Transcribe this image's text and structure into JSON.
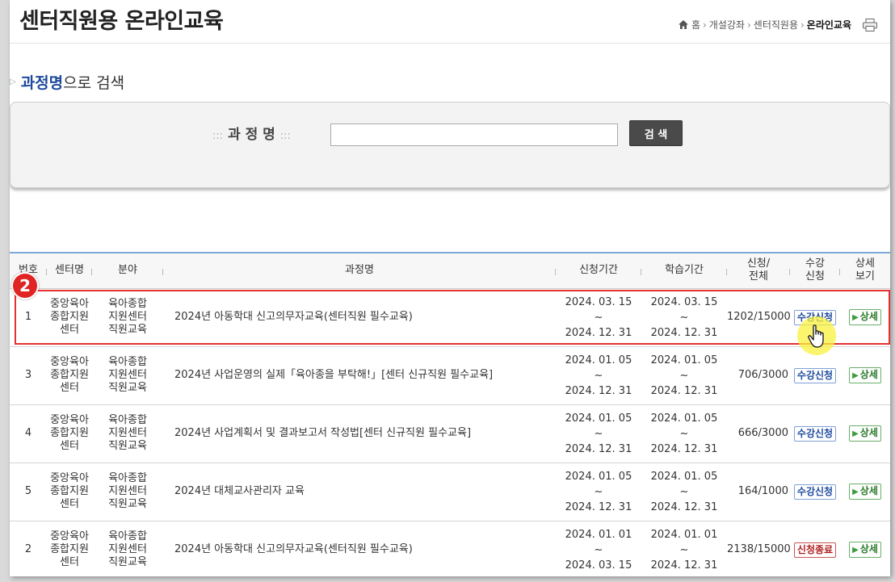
{
  "header": {
    "title": "센터직원용 온라인교육",
    "breadcrumb": [
      "홈",
      "개설강좌",
      "센터직원용",
      "온라인교육"
    ],
    "icons": {
      "home": "home-icon",
      "print": "printer-icon"
    }
  },
  "search": {
    "section_title_highlight": "과정명",
    "section_title_rest": "으로 검색",
    "label_dots": ":::",
    "label": "과 정 명",
    "input_value": "",
    "button_label": "검 색"
  },
  "table": {
    "headers": {
      "no": "번호",
      "center": "센터명",
      "field": "분야",
      "course": "과정명",
      "apply_period": "신청기간",
      "study_period": "학습기간",
      "count_l1": "신청/",
      "count_l2": "전체",
      "enroll_l1": "수강",
      "enroll_l2": "신청",
      "detail_l1": "상세",
      "detail_l2": "보기"
    },
    "rows": [
      {
        "no": "1",
        "center1": "중앙육아",
        "center2": "종합지원",
        "center3": "센터",
        "field1": "육아종합",
        "field2": "지원센터",
        "field3": "직원교육",
        "course": "2024년 아동학대 신고의무자교육(센터직원 필수교육)",
        "apply_start": "2024. 03. 15",
        "apply_end": "2024. 12. 31",
        "study_start": "2024. 03. 15",
        "study_end": "2024. 12. 31",
        "tilde": "~",
        "count": "1202/15000",
        "enroll": "수강신청",
        "detail": "상세"
      },
      {
        "no": "3",
        "center1": "중앙육아",
        "center2": "종합지원",
        "center3": "센터",
        "field1": "육아종합",
        "field2": "지원센터",
        "field3": "직원교육",
        "course": "2024년 사업운영의 실제「육아종을 부탁해!」[센터 신규직원 필수교육]",
        "apply_start": "2024. 01. 05",
        "apply_end": "2024. 12. 31",
        "study_start": "2024. 01. 05",
        "study_end": "2024. 12. 31",
        "tilde": "~",
        "count": "706/3000",
        "enroll": "수강신청",
        "detail": "상세"
      },
      {
        "no": "4",
        "center1": "중앙육아",
        "center2": "종합지원",
        "center3": "센터",
        "field1": "육아종합",
        "field2": "지원센터",
        "field3": "직원교육",
        "course": "2024년 사업계획서 및 결과보고서 작성법[센터 신규직원 필수교육]",
        "apply_start": "2024. 01. 05",
        "apply_end": "2024. 12. 31",
        "study_start": "2024. 01. 05",
        "study_end": "2024. 12. 31",
        "tilde": "~",
        "count": "666/3000",
        "enroll": "수강신청",
        "detail": "상세"
      },
      {
        "no": "5",
        "center1": "중앙육아",
        "center2": "종합지원",
        "center3": "센터",
        "field1": "육아종합",
        "field2": "지원센터",
        "field3": "직원교육",
        "course": "2024년 대체교사관리자 교육",
        "apply_start": "2024. 01. 05",
        "apply_end": "2024. 12. 31",
        "study_start": "2024. 01. 05",
        "study_end": "2024. 12. 31",
        "tilde": "~",
        "count": "164/1000",
        "enroll": "수강신청",
        "detail": "상세"
      },
      {
        "no": "2",
        "center1": "중앙육아",
        "center2": "종합지원",
        "center3": "센터",
        "field1": "육아종합",
        "field2": "지원센터",
        "field3": "직원교육",
        "course": "2024년 아동학대 신고의무자교육(센터직원 필수교육)",
        "apply_start": "2024. 01. 01",
        "apply_end": "2024. 03. 15",
        "study_start": "2024. 01. 01",
        "study_end": "2024. 12. 31",
        "tilde": "~",
        "count": "2138/15000",
        "enroll": "신청종료",
        "detail": "상세"
      }
    ]
  },
  "overlay": {
    "step_number": "2",
    "highlight_color": "#e53030",
    "cursor_icon": "hand-pointer-icon"
  },
  "colors": {
    "accent": "#1e4a9c",
    "header_line": "#7ea8d8",
    "apply": "#1e4a9c",
    "closed": "#b01e1e",
    "detail": "#2a7a2a"
  }
}
